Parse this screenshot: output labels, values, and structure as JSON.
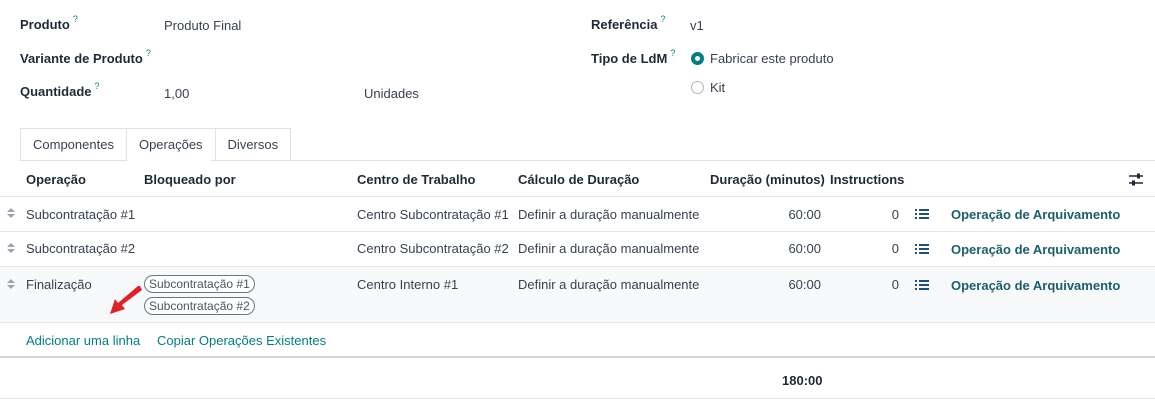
{
  "form": {
    "produto_label": "Produto",
    "produto_value": "Produto Final",
    "variante_label": "Variante de Produto",
    "quantidade_label": "Quantidade",
    "quantidade_value": "1,00",
    "quantidade_unit": "Unidades",
    "referencia_label": "Referência",
    "referencia_value": "v1",
    "tipo_label": "Tipo de LdM",
    "tipo_options": [
      "Fabricar este produto",
      "Kit"
    ],
    "tipo_selected": "Fabricar este produto",
    "help_mark": "?"
  },
  "tabs": [
    "Componentes",
    "Operações",
    "Diversos"
  ],
  "active_tab": "Operações",
  "table": {
    "headers": {
      "operacao": "Operação",
      "bloqueado": "Bloqueado por",
      "centro": "Centro de Trabalho",
      "calculo": "Cálculo de Duração",
      "duracao": "Duração (minutos)",
      "instructions": "Instructions"
    },
    "rows": [
      {
        "operacao": "Subcontratação #1",
        "bloqueado": [],
        "centro": "Centro Subcontratação #1",
        "calculo": "Definir a duração manualmente",
        "duracao": "60:00",
        "instructions": "0",
        "action": "Operação de Arquivamento"
      },
      {
        "operacao": "Subcontratação #2",
        "bloqueado": [],
        "centro": "Centro Subcontratação #2",
        "calculo": "Definir a duração manualmente",
        "duracao": "60:00",
        "instructions": "0",
        "action": "Operação de Arquivamento"
      },
      {
        "operacao": "Finalização",
        "bloqueado": [
          "Subcontratação #1",
          "Subcontratação #2"
        ],
        "centro": "Centro Interno #1",
        "calculo": "Definir a duração manualmente",
        "duracao": "60:00",
        "instructions": "0",
        "action": "Operação de Arquivamento"
      }
    ],
    "add_line": "Adicionar uma linha",
    "copy_ops": "Copiar Operações Existentes",
    "total_duration": "180:00"
  },
  "colors": {
    "accent": "#017e84",
    "link_dark": "#1b5f6b",
    "arrow": "#e0202a"
  },
  "icons": [
    "help-icon",
    "radio-icon",
    "drag-handle-icon",
    "list-icon",
    "optional-columns-icon",
    "arrow-annotation-icon"
  ]
}
